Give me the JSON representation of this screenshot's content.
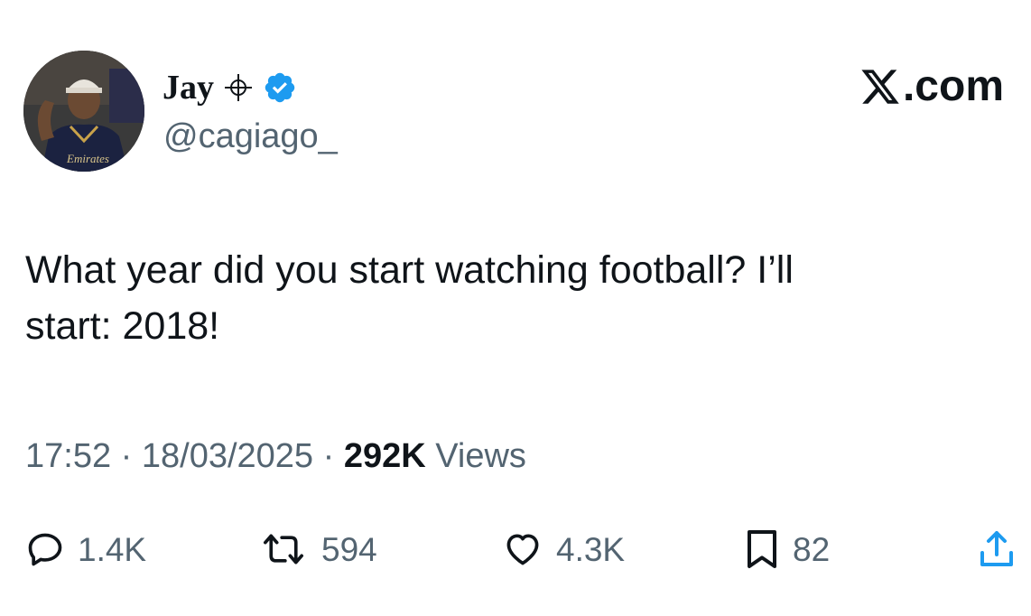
{
  "author": {
    "display_name": "Jay",
    "handle": "@cagiago_",
    "avatar_icon": "profile-photo",
    "affiliation_icon": "crosshair-icon",
    "verified_icon": "verified-badge-icon",
    "verified_color": "#1d9bf0"
  },
  "brand": {
    "label": ".com",
    "logo_icon": "x-logo-icon"
  },
  "tweet": {
    "text_line1": "What year did you start watching football? I’ll",
    "text_line2": "start: 2018!"
  },
  "meta": {
    "time": "17:52",
    "separator": "·",
    "date": "18/03/2025",
    "views_count": "292K",
    "views_label": "Views"
  },
  "actions": {
    "replies": "1.4K",
    "reposts": "594",
    "likes": "4.3K",
    "bookmarks": "82"
  },
  "colors": {
    "text_primary": "#0f1419",
    "text_secondary": "#536471",
    "verified": "#1d9bf0"
  }
}
